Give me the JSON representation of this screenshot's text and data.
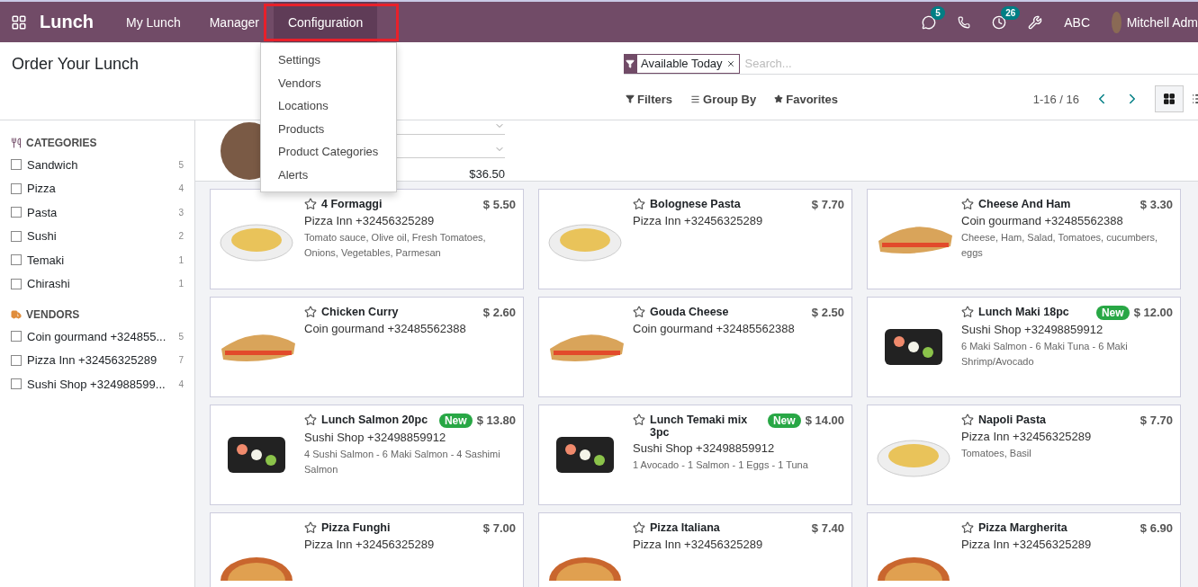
{
  "navbar": {
    "app_name": "Lunch",
    "menus": [
      {
        "label": "My Lunch",
        "selected": false
      },
      {
        "label": "Manager",
        "selected": false
      },
      {
        "label": "Configuration",
        "selected": true,
        "highlighted": true
      }
    ],
    "messages_count": "5",
    "activities_count": "26",
    "company": "ABC",
    "user": "Mitchell Adm"
  },
  "dropdown_menu": {
    "items": [
      "Settings",
      "Vendors",
      "Locations",
      "Products",
      "Product Categories",
      "Alerts"
    ]
  },
  "control_panel": {
    "title": "Order Your Lunch",
    "facet": "Available Today",
    "search_placeholder": "Search...",
    "filters": "Filters",
    "group_by": "Group By",
    "favorites": "Favorites",
    "pager": "1-16 / 16",
    "views": [
      {
        "kind": "kanban",
        "selected": true
      },
      {
        "kind": "list",
        "selected": false
      }
    ]
  },
  "account": {
    "amount": "$36.50"
  },
  "sidebar": {
    "sections": [
      {
        "kind": "categories",
        "title": "CATEGORIES",
        "items": [
          {
            "label": "Sandwich",
            "count": "5",
            "checked": false
          },
          {
            "label": "Pizza",
            "count": "4",
            "checked": false
          },
          {
            "label": "Pasta",
            "count": "3",
            "checked": false
          },
          {
            "label": "Sushi",
            "count": "2",
            "checked": false
          },
          {
            "label": "Temaki",
            "count": "1",
            "checked": false
          },
          {
            "label": "Chirashi",
            "count": "1",
            "checked": false
          }
        ]
      },
      {
        "kind": "vendors",
        "title": "VENDORS",
        "items": [
          {
            "label": "Coin gourmand +324855...",
            "count": "5",
            "checked": false
          },
          {
            "label": "Pizza Inn +32456325289",
            "count": "7",
            "checked": false
          },
          {
            "label": "Sushi Shop +324988599...",
            "count": "4",
            "checked": false
          }
        ]
      }
    ]
  },
  "products": [
    {
      "name": "4 Formaggi",
      "price": "$ 5.50",
      "vendor": "Pizza Inn +32456325289",
      "description": "Tomato sauce, Olive oil, Fresh Tomatoes, Onions, Vegetables, Parmesan",
      "is_new": false,
      "kind": "pasta"
    },
    {
      "name": "Bolognese Pasta",
      "price": "$ 7.70",
      "vendor": "Pizza Inn +32456325289",
      "is_new": false,
      "kind": "pasta"
    },
    {
      "name": "Cheese And Ham",
      "price": "$ 3.30",
      "vendor": "Coin gourmand +32485562388",
      "description": "Cheese, Ham, Salad, Tomatoes, cucumbers, eggs",
      "is_new": false,
      "kind": "sandwich"
    },
    {
      "name": "Chicken Curry",
      "price": "$ 2.60",
      "vendor": "Coin gourmand +32485562388",
      "is_new": false,
      "kind": "sandwich"
    },
    {
      "name": "Gouda Cheese",
      "price": "$ 2.50",
      "vendor": "Coin gourmand +32485562388",
      "is_new": false,
      "kind": "sandwich"
    },
    {
      "name": "Lunch Maki 18pc",
      "price": "$ 12.00",
      "vendor": "Sushi Shop +32498859912",
      "description": "6 Maki Salmon - 6 Maki Tuna - 6 Maki Shrimp/Avocado",
      "is_new": true,
      "new_label": "New",
      "kind": "sushi"
    },
    {
      "name": "Lunch Salmon 20pc",
      "price": "$ 13.80",
      "vendor": "Sushi Shop +32498859912",
      "description": "4 Sushi Salmon - 6 Maki Salmon - 4 Sashimi Salmon",
      "is_new": true,
      "new_label": "New",
      "kind": "sushi"
    },
    {
      "name": "Lunch Temaki mix 3pc",
      "price": "$ 14.00",
      "vendor": "Sushi Shop +32498859912",
      "description": "1 Avocado - 1 Salmon - 1 Eggs - 1 Tuna",
      "is_new": true,
      "new_label": "New",
      "kind": "sushi"
    },
    {
      "name": "Napoli Pasta",
      "price": "$ 7.70",
      "vendor": "Pizza Inn +32456325289",
      "description": "Tomatoes, Basil",
      "is_new": false,
      "kind": "pasta"
    },
    {
      "name": "Pizza Funghi",
      "price": "$ 7.00",
      "vendor": "Pizza Inn +32456325289",
      "is_new": false,
      "kind": "pizza"
    },
    {
      "name": "Pizza Italiana",
      "price": "$ 7.40",
      "vendor": "Pizza Inn +32456325289",
      "is_new": false,
      "kind": "pizza"
    },
    {
      "name": "Pizza Margherita",
      "price": "$ 6.90",
      "vendor": "Pizza Inn +32456325289",
      "is_new": false,
      "kind": "pizza"
    }
  ]
}
